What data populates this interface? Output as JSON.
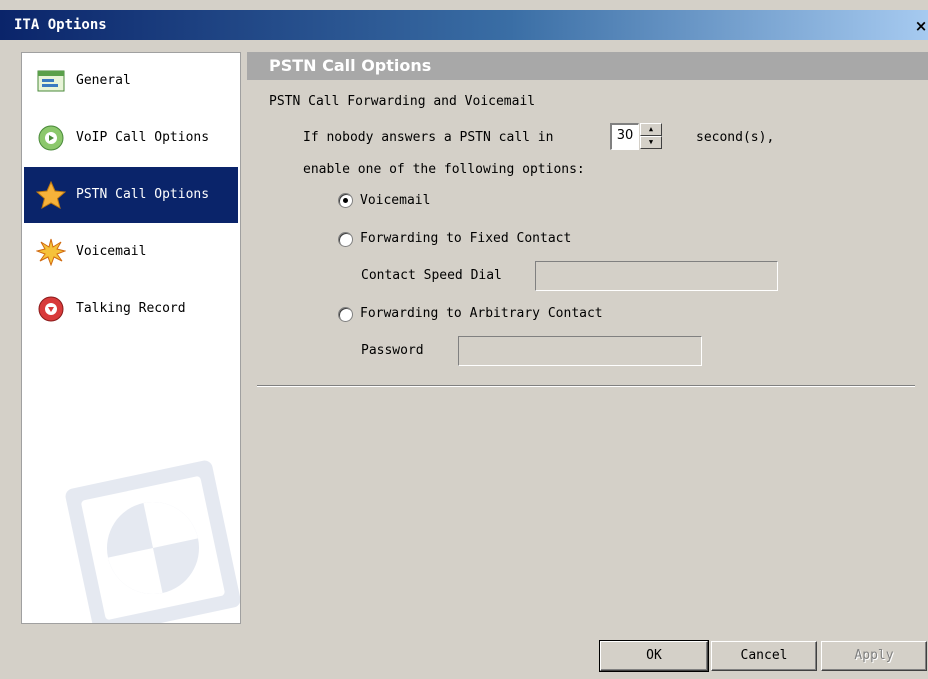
{
  "window": {
    "title": "ITA Options",
    "close_glyph": "×"
  },
  "sidebar": {
    "items": [
      {
        "label": "General",
        "icon": "general-icon",
        "selected": false
      },
      {
        "label": "VoIP Call Options",
        "icon": "voip-icon",
        "selected": false
      },
      {
        "label": "PSTN Call Options",
        "icon": "star-icon",
        "selected": true
      },
      {
        "label": "Voicemail",
        "icon": "voicemail-burst-icon",
        "selected": false
      },
      {
        "label": "Talking Record",
        "icon": "record-icon",
        "selected": false
      }
    ]
  },
  "panel": {
    "header": "PSTN Call Options",
    "group_title": "PSTN Call Forwarding and Voicemail",
    "no_answer_text": "If nobody answers a PSTN call in",
    "seconds_value": "30",
    "seconds_unit": "second(s),",
    "enable_text": "enable one of the following options:",
    "options": {
      "voicemail": {
        "label": "Voicemail",
        "checked": true
      },
      "fixed_contact": {
        "label": "Forwarding to Fixed Contact",
        "checked": false
      },
      "arbitrary_contact": {
        "label": "Forwarding to Arbitrary Contact",
        "checked": false
      }
    },
    "contact_speed_dial": {
      "label": "Contact Speed Dial",
      "value": ""
    },
    "password": {
      "label": "Password",
      "value": ""
    }
  },
  "buttons": {
    "ok": "OK",
    "cancel": "Cancel",
    "apply": "Apply"
  },
  "colors": {
    "selection": "#0a246a",
    "header_bg": "#a8a8a8",
    "window_bg": "#d4d0c8"
  }
}
